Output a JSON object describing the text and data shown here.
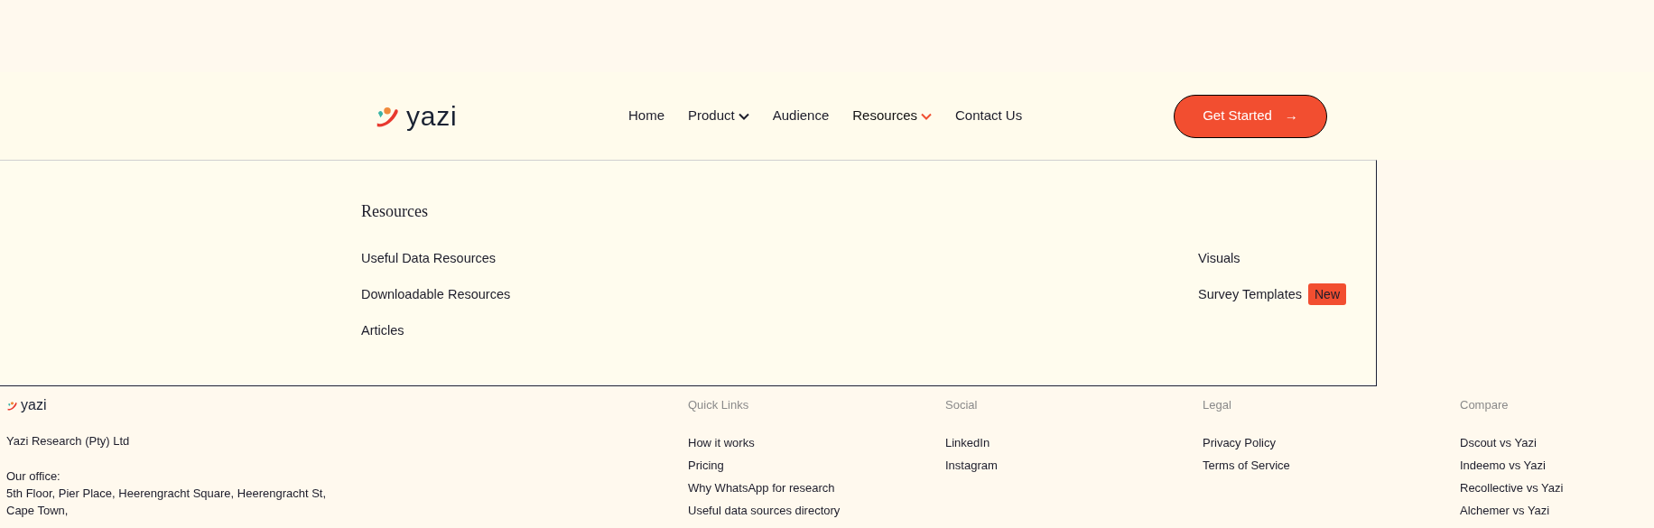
{
  "header": {
    "logo_text": "yazi",
    "nav": [
      {
        "label": "Home",
        "dropdown": false,
        "expanded": false
      },
      {
        "label": "Product",
        "dropdown": true,
        "expanded": false
      },
      {
        "label": "Audience",
        "dropdown": false,
        "expanded": false
      },
      {
        "label": "Resources",
        "dropdown": true,
        "expanded": true
      },
      {
        "label": "Contact Us",
        "dropdown": false,
        "expanded": false
      }
    ],
    "cta": {
      "label": "Get Started",
      "arrow": "→"
    }
  },
  "dropdown": {
    "title": "Resources",
    "left_items": [
      {
        "label": "Useful Data Resources"
      },
      {
        "label": "Downloadable Resources"
      },
      {
        "label": "Articles"
      }
    ],
    "right_items": [
      {
        "label": "Visuals"
      },
      {
        "label": "Survey Templates",
        "badge": "New"
      }
    ]
  },
  "footer": {
    "logo_text": "yazi",
    "company": "Yazi Research (Pty) Ltd",
    "office_label": "Our office:",
    "address": [
      "5th Floor, Pier Place, Heerengracht Square, Heerengracht St,",
      "Cape Town,"
    ],
    "columns": [
      {
        "title": "Quick Links",
        "links": [
          "How it works",
          "Pricing",
          "Why WhatsApp for research",
          "Useful data sources directory"
        ]
      },
      {
        "title": "Social",
        "links": [
          "LinkedIn",
          "Instagram"
        ]
      },
      {
        "title": "Legal",
        "links": [
          "Privacy Policy",
          "Terms of Service"
        ]
      },
      {
        "title": "Compare",
        "links": [
          "Dscout vs Yazi",
          "Indeemo vs Yazi",
          "Recollective vs Yazi",
          "Alchemer vs Yazi"
        ]
      }
    ]
  }
}
